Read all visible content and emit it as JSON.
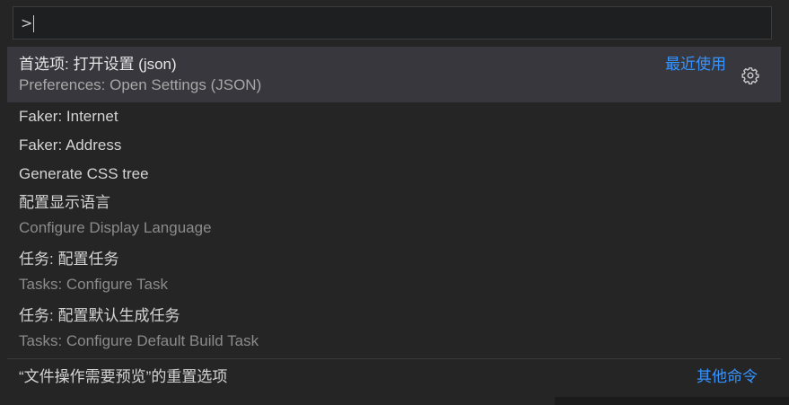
{
  "search": {
    "value": ">",
    "placeholder": ""
  },
  "items": [
    {
      "label": "首选项: 打开设置 (json)",
      "sub": "Preferences: Open Settings (JSON)",
      "tag": "最近使用",
      "selected": true,
      "icon": "gear-icon"
    },
    {
      "label": "Faker: Internet"
    },
    {
      "label": "Faker: Address"
    },
    {
      "label": "Generate CSS tree"
    },
    {
      "label": "配置显示语言",
      "sub": "Configure Display Language"
    },
    {
      "label": "任务: 配置任务",
      "sub": "Tasks: Configure Task"
    },
    {
      "label": "任务: 配置默认生成任务",
      "sub": "Tasks: Configure Default Build Task"
    }
  ],
  "footer": {
    "text": "“文件操作需要预览”的重置选项",
    "link": "其他命令"
  },
  "colors": {
    "accent": "#3794ff",
    "selected_bg": "#37373d",
    "background": "#252526"
  }
}
